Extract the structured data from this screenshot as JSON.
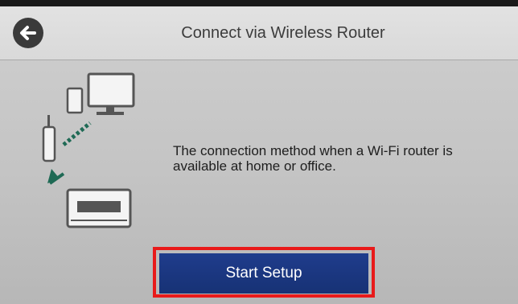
{
  "header": {
    "title": "Connect via Wireless Router",
    "back_icon": "arrow-left-icon"
  },
  "main": {
    "description": "The connection method when a Wi-Fi router is available at home or office.",
    "illustration_icons": [
      "monitor-icon",
      "phone-icon",
      "router-icon",
      "printer-icon",
      "arrow-icon"
    ]
  },
  "footer": {
    "start_setup_label": "Start Setup"
  },
  "colors": {
    "button_blue": "#1f3c8c",
    "highlight_red": "#e81a1a",
    "arrow_green": "#1f6a55"
  }
}
